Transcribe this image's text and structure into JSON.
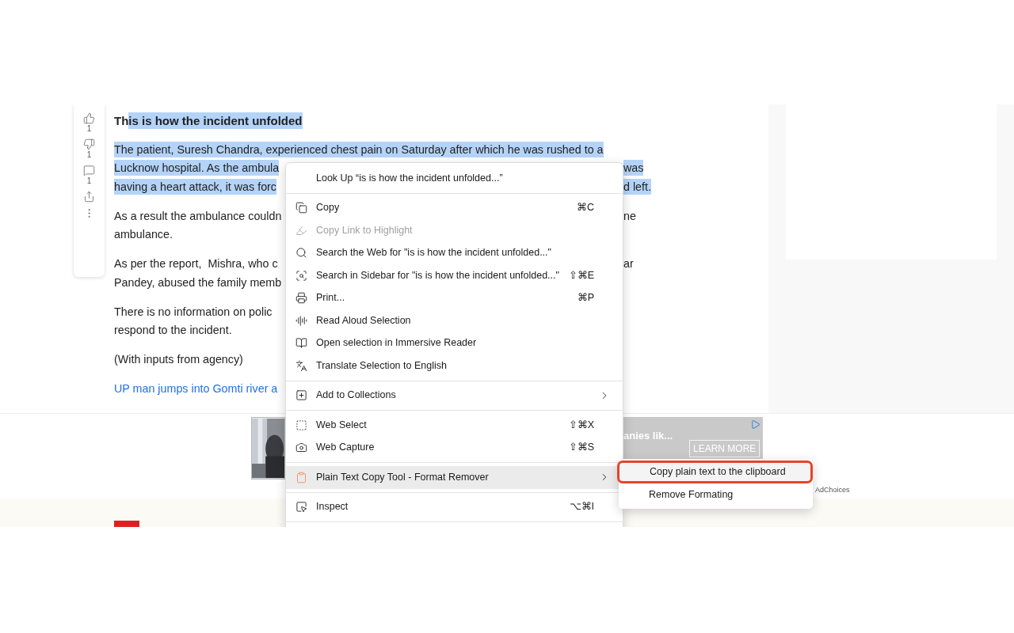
{
  "actions": [
    {
      "kind": "like",
      "count": "1"
    },
    {
      "kind": "dislike",
      "count": "1"
    },
    {
      "kind": "comment",
      "count": "1"
    },
    {
      "kind": "share"
    },
    {
      "kind": "more"
    }
  ],
  "article": {
    "heading": [
      {
        "text": "Th",
        "selected": false
      },
      {
        "text": "is is how the incident unfolded",
        "selected": true
      }
    ],
    "paragraphs": [
      {
        "lines": [
          {
            "left": {
              "text": "The patient, Suresh Chandra, experienced chest pain on Saturday after which he was rushed to a",
              "selected": true
            }
          },
          {
            "left": {
              "text": "Lucknow hospital. As the ambula",
              "selected": true
            },
            "right": {
              "text": "was",
              "selected": true
            }
          },
          {
            "left": {
              "text": "having a heart attack, it was forc",
              "selected": true
            },
            "right": {
              "text": "d left.",
              "selected": true
            }
          }
        ]
      },
      {
        "lines": [
          {
            "left": {
              "text": "As a result the ambulance couldn",
              "selected": false
            },
            "right": {
              "text": "ne",
              "selected": false
            }
          },
          {
            "left": {
              "text": "ambulance.",
              "selected": false
            }
          }
        ]
      },
      {
        "lines": [
          {
            "left": {
              "text": "As per the report,  Mishra, who c",
              "selected": false
            },
            "right": {
              "text": "ar",
              "selected": false
            }
          },
          {
            "left": {
              "text": "Pandey, abused the family memb",
              "selected": false
            }
          }
        ]
      },
      {
        "lines": [
          {
            "left": {
              "text": "There is no information on polic",
              "selected": false
            }
          },
          {
            "left": {
              "text": "respond to the incident.",
              "selected": false
            }
          }
        ]
      },
      {
        "lines": [
          {
            "left": {
              "text": "(With inputs from agency)",
              "selected": false
            }
          }
        ]
      }
    ],
    "link": "UP man jumps into Gomti river a"
  },
  "ad": {
    "headline": "anies lik...",
    "button": "LEARN MORE",
    "adchoices": "AdChoices"
  },
  "context_menu": {
    "items": [
      {
        "kind": "item",
        "label": "Look Up “is is how the incident unfolded...”",
        "disabled": false,
        "selected": false
      },
      {
        "kind": "separator"
      },
      {
        "kind": "item",
        "label": "Copy",
        "shortcut": "⌘C",
        "disabled": false,
        "selected": false
      },
      {
        "kind": "item",
        "label": "Copy Link to Highlight",
        "disabled": true,
        "selected": false
      },
      {
        "kind": "item",
        "label": "Search the Web for \"is is how the incident unfolded...\"",
        "disabled": false,
        "selected": false
      },
      {
        "kind": "item",
        "label": "Search in Sidebar for \"is is how the incident unfolded...\"",
        "shortcut": "⇧⌘E",
        "disabled": false,
        "selected": false
      },
      {
        "kind": "item",
        "label": "Print...",
        "shortcut": "⌘P",
        "disabled": false,
        "selected": false
      },
      {
        "kind": "item",
        "label": "Read Aloud Selection",
        "disabled": false,
        "selected": false
      },
      {
        "kind": "item",
        "label": "Open selection in Immersive Reader",
        "disabled": false,
        "selected": false
      },
      {
        "kind": "item",
        "label": "Translate Selection to English",
        "disabled": false,
        "selected": false
      },
      {
        "kind": "separator"
      },
      {
        "kind": "item",
        "label": "Add to Collections",
        "submenu": true,
        "disabled": false,
        "selected": false
      },
      {
        "kind": "separator"
      },
      {
        "kind": "item",
        "label": "Web Select",
        "shortcut": "⇧⌘X",
        "disabled": false,
        "selected": false
      },
      {
        "kind": "item",
        "label": "Web Capture",
        "shortcut": "⇧⌘S",
        "disabled": false,
        "selected": false
      },
      {
        "kind": "separator"
      },
      {
        "kind": "item",
        "label": "Plain Text Copy Tool - Format Remover",
        "submenu": true,
        "disabled": false,
        "selected": true
      },
      {
        "kind": "separator"
      },
      {
        "kind": "item",
        "label": "Inspect",
        "shortcut": "⌥⌘I",
        "disabled": false,
        "selected": false
      },
      {
        "kind": "separator"
      }
    ]
  },
  "submenu": {
    "items": [
      {
        "label": "Copy plain text to the clipboard",
        "outlined": true
      },
      {
        "label": "Remove Formating",
        "outlined": false
      }
    ]
  }
}
